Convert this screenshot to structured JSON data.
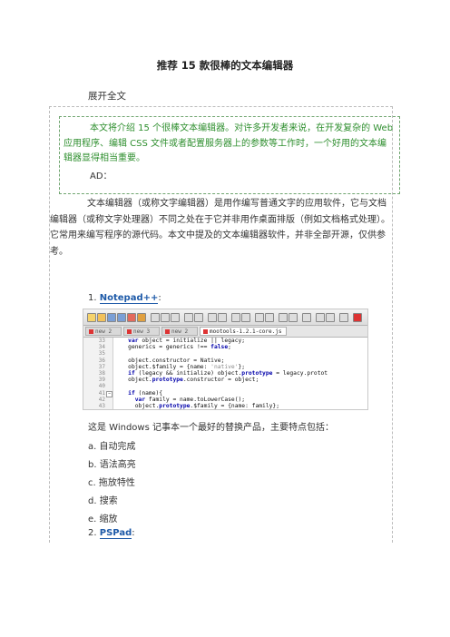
{
  "title": "推荐 15 款很棒的文本编辑器",
  "expand_label": "展开全文",
  "intro": {
    "text": "本文将介绍 15 个很棒文本编辑器。对许多开发者来说，在开发复杂的 Web 应用程序、编辑 CSS 文件或者配置服务器上的参数等工作时，一个好用的文本编辑器显得相当重要。",
    "ad": "AD："
  },
  "paragraph": "文本编辑器（或称文字编辑器）是用作编写普通文字的应用软件，它与文档编辑器（或称文字处理器）不同之处在于它并非用作桌面排版（例如文档格式处理）。它常用来编写程序的源代码。本文中提及的文本编辑器软件，并非全部开源，仅供参考。",
  "item1": {
    "number": "1.",
    "link": "Notepad++",
    "suffix": ":"
  },
  "editor": {
    "tabs": [
      "new 2",
      "new 3",
      "new 2",
      "mootools-1.2.1-core.js"
    ],
    "lines": [
      {
        "n": "33",
        "code": "    var object = initialize || legacy;"
      },
      {
        "n": "34",
        "code": "    generics = generics !== false;"
      },
      {
        "n": "35",
        "code": ""
      },
      {
        "n": "36",
        "code": "    object.constructor = Native;"
      },
      {
        "n": "37",
        "code": "    object.$family = {name: 'native'};"
      },
      {
        "n": "38",
        "code": "    if (legacy && initialize) object.prototype = legacy.protot"
      },
      {
        "n": "39",
        "code": "    object.prototype.constructor = object;"
      },
      {
        "n": "40",
        "code": ""
      },
      {
        "n": "41",
        "code": "    if (name){"
      },
      {
        "n": "42",
        "code": "      var family = name.toLowerCase();"
      },
      {
        "n": "43",
        "code": "      object.prototype.$family = {name: family};"
      }
    ]
  },
  "desc": "这是 Windows 记事本一个最好的替换产品，主要特点包括：",
  "features": [
    "a. 自动完成",
    "b. 语法高亮",
    "c. 拖放特性",
    "d. 搜索",
    "e. 缩放"
  ],
  "item2": {
    "number": "2.",
    "link": "PSPad",
    "suffix": ":"
  },
  "colors": {
    "intro_green": "#2f8f2f",
    "link_blue": "#1e5aa8",
    "keyword": "#0000aa"
  }
}
